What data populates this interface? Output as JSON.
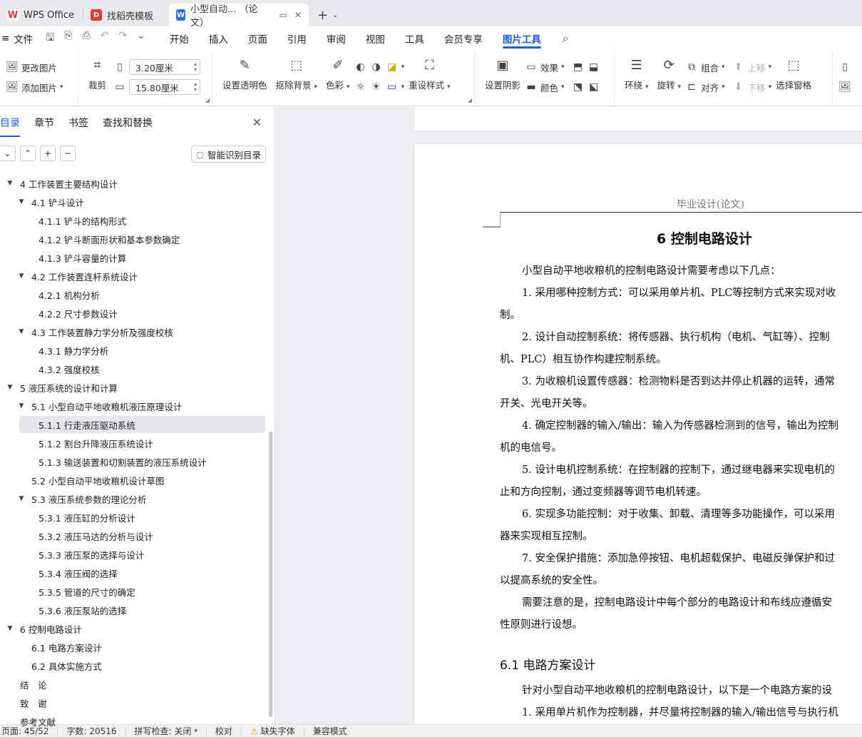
{
  "tabs": [
    {
      "label": "WPS Office",
      "icon": "wps-logo-icon",
      "color": "#e8382f"
    },
    {
      "label": "找稻壳模板",
      "icon": "docer-icon",
      "color": "#e8382f"
    },
    {
      "label": "小型自动... （论文）",
      "icon": "writer-icon",
      "color": "#2a6ee8",
      "active": true
    }
  ],
  "menubar": {
    "file_label": "文件",
    "items": [
      "开始",
      "插入",
      "页面",
      "引用",
      "审阅",
      "视图",
      "工具",
      "会员专享",
      "图片工具"
    ],
    "active": "图片工具"
  },
  "ribbon": {
    "change_image": "更改图片",
    "add_image": "添加图片",
    "crop": "裁剪",
    "width_value": "3.20厘米",
    "height_value": "15.80厘米",
    "set_transparent": "设置透明色",
    "remove_bg": "抠除背景",
    "color_tone": "色彩",
    "reset_style": "重设样式",
    "set_shadow": "设置阴影",
    "effect": "效果",
    "color": "颜色",
    "wrap": "环绕",
    "rotate": "旋转",
    "group": "组合",
    "align": "对齐",
    "move_up": "上移",
    "move_down": "下移",
    "select_pane": "选择窗格"
  },
  "nav": {
    "tabs": [
      "目录",
      "章节",
      "书签",
      "查找和替换"
    ],
    "active_tab": "目录",
    "smart_toc": "智能识别目录",
    "items": [
      {
        "label": "4 工作装置主要结构设计",
        "level": 1,
        "expanded": true
      },
      {
        "label": "4.1 铲斗设计",
        "level": 2,
        "expanded": true
      },
      {
        "label": "4.1.1 铲斗的结构形式",
        "level": 3
      },
      {
        "label": "4.1.2 铲斗断面形状和基本参数确定",
        "level": 3
      },
      {
        "label": "4.1.3 铲斗容量的计算",
        "level": 3
      },
      {
        "label": "4.2 工作装置连杆系统设计",
        "level": 2,
        "expanded": true
      },
      {
        "label": "4.2.1 机构分析",
        "level": 3
      },
      {
        "label": "4.2.2 尺寸参数设计",
        "level": 3
      },
      {
        "label": "4.3 工作装置静力学分析及强度校核",
        "level": 2,
        "expanded": true
      },
      {
        "label": "4.3.1 静力学分析",
        "level": 3
      },
      {
        "label": "4.3.2 强度校核",
        "level": 3
      },
      {
        "label": "5 液压系统的设计和计算",
        "level": 1,
        "expanded": true
      },
      {
        "label": "5.1 小型自动平地收粮机液压原理设计",
        "level": 2,
        "expanded": true
      },
      {
        "label": "5.1.1 行走液压驱动系统",
        "level": 3,
        "selected": true
      },
      {
        "label": "5.1.2 割台升降液压系统设计",
        "level": 3
      },
      {
        "label": "5.1.3 输送装置和切割装置的液压系统设计",
        "level": 3
      },
      {
        "label": "5.2 小型自动平地收粮机设计草图",
        "level": 2
      },
      {
        "label": "5.3 液压系统参数的理论分析",
        "level": 2,
        "expanded": true
      },
      {
        "label": "5.3.1 液压缸的分析设计",
        "level": 3
      },
      {
        "label": "5.3.2 液压马达的分析与设计",
        "level": 3
      },
      {
        "label": "5.3.3 液压泵的选择与设计",
        "level": 3
      },
      {
        "label": "5.3.4 液压阀的选择",
        "level": 3
      },
      {
        "label": "5.3.5 管道的尺寸的确定",
        "level": 3
      },
      {
        "label": "5.3.6 液压泵站的选择",
        "level": 3
      },
      {
        "label": "6 控制电路设计",
        "level": 1,
        "expanded": true
      },
      {
        "label": "6.1 电路方案设计",
        "level": 2
      },
      {
        "label": "6.2 具体实施方式",
        "level": 2
      },
      {
        "label": "结　论",
        "level": 1
      },
      {
        "label": "致　谢",
        "level": 1
      },
      {
        "label": "参考文献",
        "level": 1
      }
    ]
  },
  "doc": {
    "header": "毕业设计(论文)",
    "chapter_title": "6  控制电路设计",
    "lines": [
      {
        "text": "小型自动平地收粮机的控制电路设计需要考虑以下几点：",
        "indent": true
      },
      {
        "text": "1. 采用哪种控制方式：可以采用单片机、PLC等控制方式来实现对收",
        "indent": true
      },
      {
        "text": "制。",
        "indent": false
      },
      {
        "text": "2. 设计自动控制系统：将传感器、执行机构（电机、气缸等）、控制",
        "indent": true
      },
      {
        "text": "机、PLC）相互协作构建控制系统。",
        "indent": false
      },
      {
        "text": "3. 为收粮机设置传感器：检测物料是否到达并停止机器的运转，通常",
        "indent": true
      },
      {
        "text": "开关、光电开关等。",
        "indent": false
      },
      {
        "text": "4. 确定控制器的输入/输出：输入为传感器检测到的信号，输出为控制",
        "indent": true
      },
      {
        "text": "机的电信号。",
        "indent": false
      },
      {
        "text": "5. 设计电机控制系统：在控制器的控制下，通过继电器来实现电机的",
        "indent": true
      },
      {
        "text": "止和方向控制，通过变频器等调节电机转速。",
        "indent": false
      },
      {
        "text": "6. 实现多功能控制：对于收集、卸载、清理等多功能操作，可以采用",
        "indent": true
      },
      {
        "text": "器来实现相互控制。",
        "indent": false
      },
      {
        "text": "7. 安全保护措施：添加急停按钮、电机超载保护、电磁反弹保护和过",
        "indent": true
      },
      {
        "text": "以提高系统的安全性。",
        "indent": false
      },
      {
        "text": "需要注意的是，控制电路设计中每个部分的电路设计和布线应遵循安",
        "indent": true
      },
      {
        "text": "性原则进行设想。",
        "indent": false
      }
    ],
    "section_title": "6.1 电路方案设计",
    "lines2": [
      {
        "text": "针对小型自动平地收粮机的控制电路设计，以下是一个电路方案的设",
        "indent": true
      },
      {
        "text": "1. 采用单片机作为控制器，并尽量将控制器的输入/输出信号与执行机",
        "indent": true
      }
    ]
  },
  "status": {
    "page": "页面: 45/52",
    "words": "字数: 20516",
    "spell": "拼写检查: 关闭",
    "proofread": "校对",
    "missing_font": "缺失字体",
    "compat": "兼容模式"
  },
  "colors": {
    "accent": "#1a5fd6",
    "wps_red": "#e8382f",
    "writer_blue": "#2a6ee8"
  }
}
